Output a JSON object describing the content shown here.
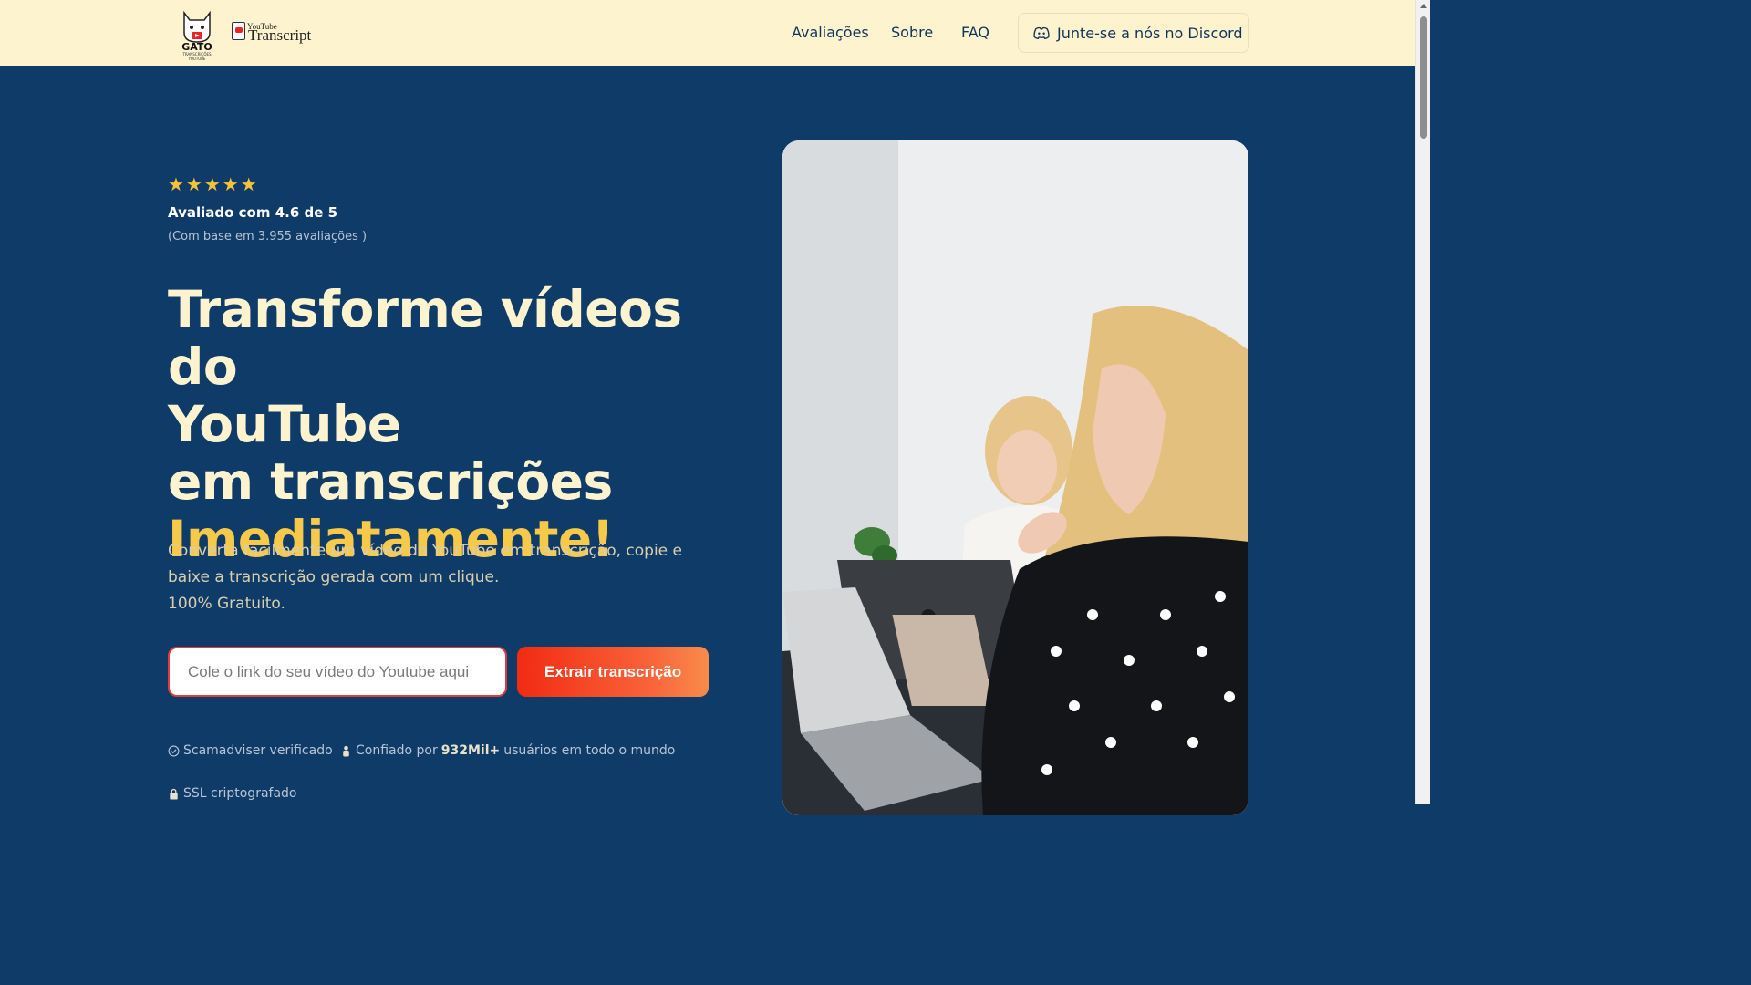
{
  "header": {
    "logo_text": "GATO",
    "logo_subtext": "TRANSCRIÇÕES YOUTUBE",
    "brand_small": "YouTube",
    "brand_big": "Transcript",
    "nav": [
      "Avaliações",
      "Sobre",
      "FAQ"
    ],
    "discord_label": "Junte-se a nós no Discord",
    "discord_icon": "discord-icon"
  },
  "hero": {
    "stars": "★★★★★",
    "star_count": 5,
    "rating_title": "Avaliado com 4.6 de 5",
    "rating_sub": "(Com base em 3.955 avaliações )",
    "headline_line1": "Transforme vídeos do",
    "headline_line2": "YouTube",
    "headline_line3": "em transcrições",
    "headline_accent": "Imediatamente!",
    "desc_line1": "Converta facilmente um vídeo do YouTube em transcrição, copie e",
    "desc_line2": "baixe a transcrição gerada com um clique.",
    "desc_line3": "100% Gratuito.",
    "input_placeholder": "Cole o link do seu vídeo do Youtube aqui",
    "input_value": "",
    "button_label": "Extrair transcrição",
    "trust": {
      "verified": "Scamadviser verificado",
      "trusted_prefix": "Confiado por",
      "trusted_count": "932Mil+",
      "trusted_suffix": "usuários em todo o mundo",
      "ssl": "SSL criptografado"
    }
  },
  "colors": {
    "header_bg": "#fdf3cf",
    "page_bg": "#0f3b69",
    "accent_yellow": "#f7c948",
    "button_start": "#f12b11",
    "button_end": "#f98b4b",
    "input_border": "#e23b3b"
  }
}
